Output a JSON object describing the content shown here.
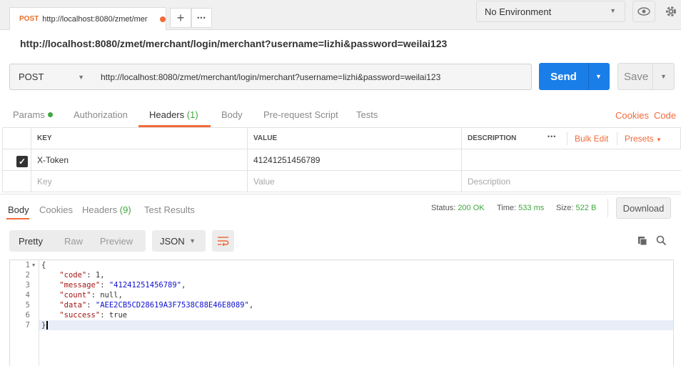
{
  "tabbar": {
    "request_tab": {
      "method": "POST",
      "url": "http://localhost:8080/zmet/mer"
    },
    "add_tab_label": "+",
    "more_label": "•••"
  },
  "environment": {
    "selected": "No Environment"
  },
  "request": {
    "title_url": "http://localhost:8080/zmet/merchant/login/merchant?username=lizhi&password=weilai123",
    "method": "POST",
    "url": "http://localhost:8080/zmet/merchant/login/merchant?username=lizhi&password=weilai123",
    "send_label": "Send",
    "save_label": "Save"
  },
  "request_tabs": {
    "params": "Params",
    "authorization": "Authorization",
    "headers": "Headers",
    "headers_count": "(1)",
    "body": "Body",
    "prerequest": "Pre-request Script",
    "tests": "Tests",
    "cookies": "Cookies",
    "code": "Code"
  },
  "headers_table": {
    "col_key": "KEY",
    "col_value": "VALUE",
    "col_description": "DESCRIPTION",
    "more": "•••",
    "bulk_edit": "Bulk Edit",
    "presets": "Presets",
    "rows": [
      {
        "key": "X-Token",
        "value": "41241251456789",
        "checked": true
      }
    ],
    "placeholder_key": "Key",
    "placeholder_value": "Value",
    "placeholder_description": "Description"
  },
  "response_tabs": {
    "body": "Body",
    "cookies": "Cookies",
    "headers": "Headers",
    "headers_count": "(9)",
    "test_results": "Test Results"
  },
  "response_status": {
    "status_label": "Status:",
    "status_value": "200 OK",
    "time_label": "Time:",
    "time_value": "533 ms",
    "size_label": "Size:",
    "size_value": "522 B",
    "download_label": "Download"
  },
  "view_modes": {
    "pretty": "Pretty",
    "raw": "Raw",
    "preview": "Preview",
    "format": "JSON"
  },
  "code_lines": {
    "l1_num": "1",
    "l1": "{",
    "l2_num": "2",
    "l2_key": "\"code\"",
    "l2_val": ": 1,",
    "l3_num": "3",
    "l3_key": "\"message\"",
    "l3_str": "\"41241251456789\"",
    "l4_num": "4",
    "l4_key": "\"count\"",
    "l4_val": ": null,",
    "l5_num": "5",
    "l5_key": "\"data\"",
    "l5_str": "\"AEE2CB5CD28619A3F7538C88E46E8089\"",
    "l6_num": "6",
    "l6_key": "\"success\"",
    "l6_val": ": true",
    "l7_num": "7",
    "l7": "}"
  },
  "colors": {
    "accent": "#f26b3a",
    "send": "#1a7ee8",
    "ok": "#40a73e"
  }
}
